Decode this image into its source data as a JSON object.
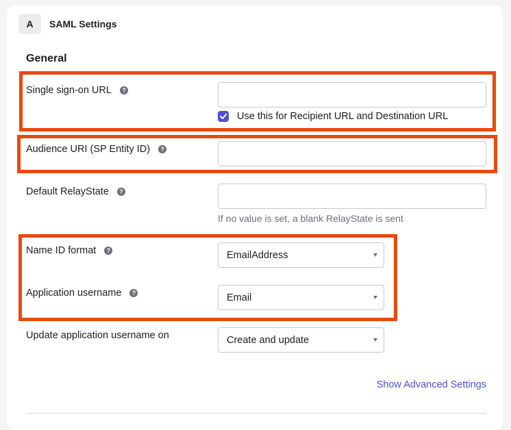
{
  "step": {
    "letter": "A",
    "title": "SAML Settings"
  },
  "section": {
    "title": "General"
  },
  "fields": {
    "sso_url": {
      "label": "Single sign-on URL",
      "value": "",
      "help": "?"
    },
    "recipient_checkbox": {
      "label": "Use this for Recipient URL and Destination URL",
      "checked": true
    },
    "audience_uri": {
      "label": "Audience URI (SP Entity ID)",
      "value": "",
      "help": "?"
    },
    "relay_state": {
      "label": "Default RelayState",
      "value": "",
      "help": "?",
      "hint": "If no value is set, a blank RelayState is sent"
    },
    "name_id_format": {
      "label": "Name ID format",
      "selected": "EmailAddress",
      "help": "?"
    },
    "app_username": {
      "label": "Application username",
      "selected": "Email",
      "help": "?"
    },
    "update_username_on": {
      "label": "Update application username on",
      "selected": "Create and update"
    }
  },
  "advanced_link": "Show Advanced Settings",
  "colors": {
    "accent": "#4f4fd1",
    "highlight": "#e84a0c",
    "help_icon": "#6e6e78"
  }
}
